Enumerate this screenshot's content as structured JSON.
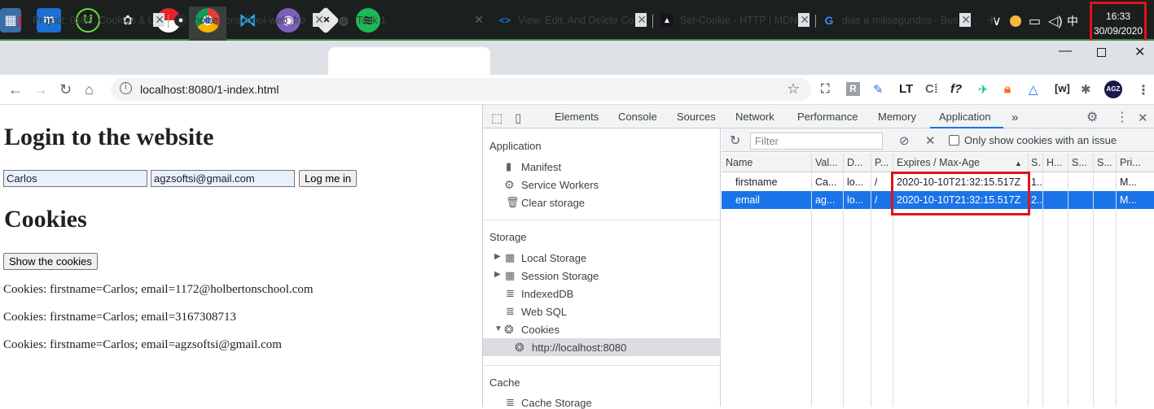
{
  "taskbar": {
    "apps": [
      "media-player",
      "maxthon-browser",
      "upwork",
      "network-tool",
      "pokeball",
      "chrome",
      "vscode",
      "github-desktop",
      "git",
      "spotify"
    ],
    "clock_time": "16:33",
    "clock_date": "30/09/2020"
  },
  "tabs": [
    {
      "title": "Project: 0x0E. Cookies & L",
      "icon": "holberton-icon"
    },
    {
      "title": "holbertonschool-web_fro",
      "icon": "github-icon"
    },
    {
      "title": "Task 1",
      "icon": "globe-icon",
      "active": true
    },
    {
      "title": "View, Edit, And Delete Co",
      "icon": "devtools-icon"
    },
    {
      "title": "Set-Cookie - HTTP | MDN",
      "icon": "mdn-icon"
    },
    {
      "title": "dias a milisegundos - Bus",
      "icon": "google-icon"
    }
  ],
  "address": {
    "url": "localhost:8080/1-index.html"
  },
  "page": {
    "title": "Login to the website",
    "firstname_value": "Carlos",
    "email_value": "agzsoftsi@gmail.com",
    "login_button": "Log me in",
    "cookies_heading": "Cookies",
    "show_button": "Show the cookies",
    "cookie_lines": [
      "Cookies: firstname=Carlos; email=1172@holbertonschool.com",
      "Cookies: firstname=Carlos; email=3167308713",
      "Cookies: firstname=Carlos; email=agzsoftsi@gmail.com"
    ]
  },
  "devtools": {
    "tabs": [
      "Elements",
      "Console",
      "Sources",
      "Network",
      "Performance",
      "Memory",
      "Application"
    ],
    "active_tab": "Application",
    "sidebar": {
      "application_heading": "Application",
      "application_items": [
        "Manifest",
        "Service Workers",
        "Clear storage"
      ],
      "storage_heading": "Storage",
      "storage_items": [
        "Local Storage",
        "Session Storage",
        "IndexedDB",
        "Web SQL",
        "Cookies"
      ],
      "cookie_origin": "http://localhost:8080",
      "cache_heading": "Cache",
      "cache_items": [
        "Cache Storage"
      ]
    },
    "cookies": {
      "filter_placeholder": "Filter",
      "only_issue_label": "Only show cookies with an issue",
      "columns": [
        "Name",
        "Val...",
        "D...",
        "P...",
        "Expires / Max-Age",
        "S.",
        "H...",
        "S...",
        "S...",
        "Pri..."
      ],
      "rows": [
        {
          "name": "firstname",
          "value": "Ca...",
          "domain": "lo...",
          "path": "/",
          "expires": "2020-10-10T21:32:15.517Z",
          "size": "1..",
          "priority": "M..."
        },
        {
          "name": "email",
          "value": "ag...",
          "domain": "lo...",
          "path": "/",
          "expires": "2020-10-10T21:32:15.517Z",
          "size": "2..",
          "priority": "M...",
          "selected": true
        }
      ]
    }
  },
  "colors": {
    "accent": "#1a73e8",
    "highlight_box": "#e0141a",
    "selected_row": "#1a73e8"
  }
}
